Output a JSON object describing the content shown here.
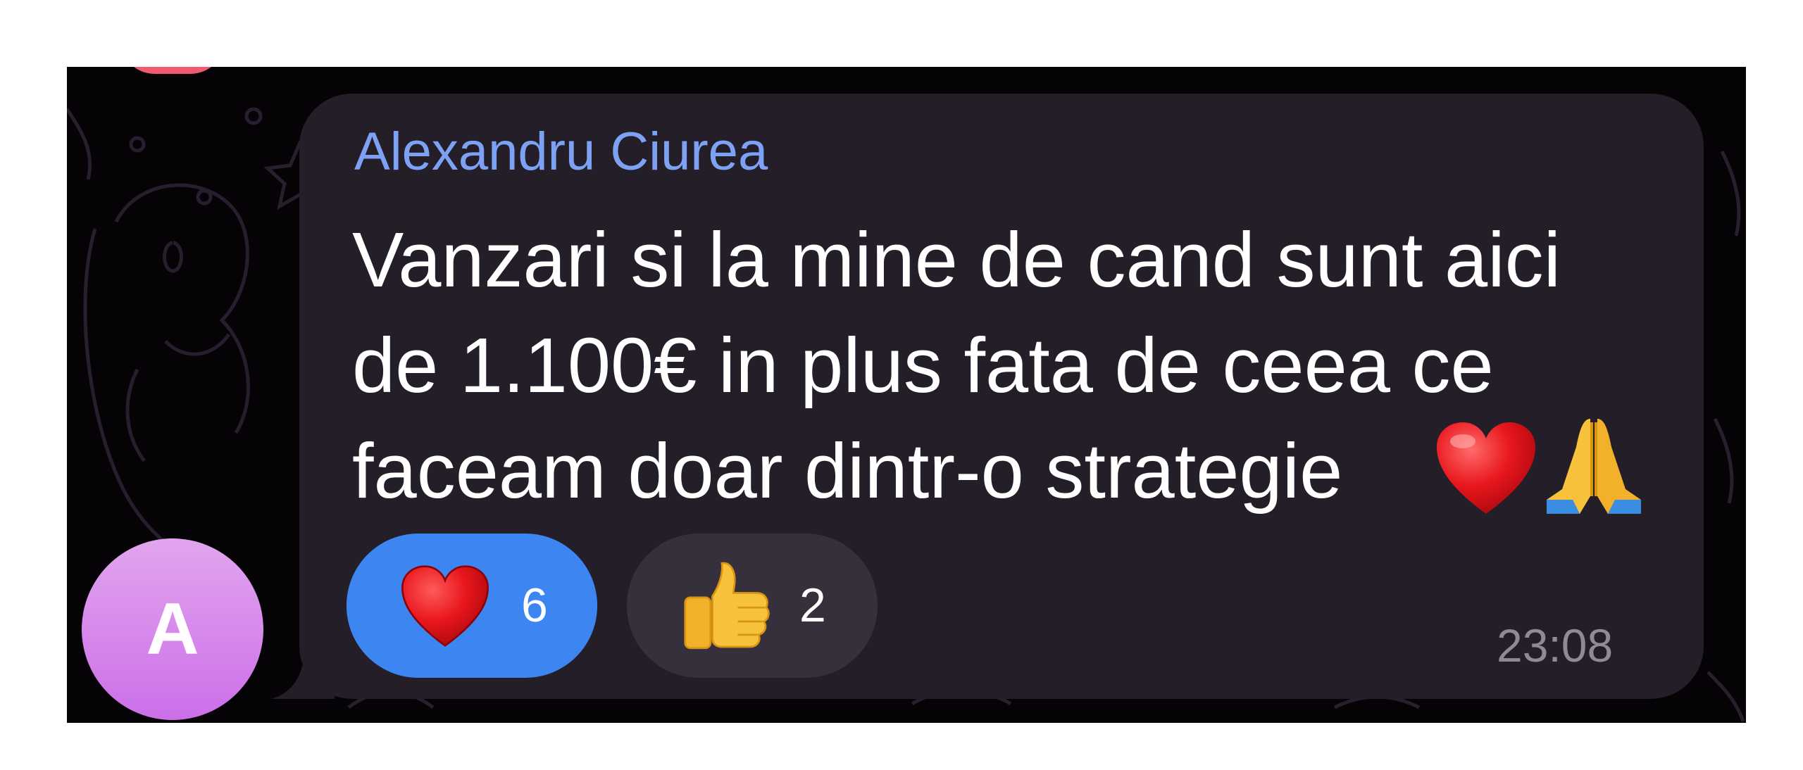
{
  "message": {
    "sender_name": "Alexandru Ciurea",
    "lines": [
      "Vanzari si la mine de cand sunt aici",
      "de 1.100€ in plus fata de ceea ce",
      "faceam doar dintr-o strategie"
    ],
    "trailing_emojis": [
      "heart-emoji",
      "folded-hands-emoji"
    ],
    "time": "23:08",
    "avatar_letter": "A"
  },
  "reactions": [
    {
      "icon": "heart-icon",
      "count": "6",
      "selected": true
    },
    {
      "icon": "thumbs-up-icon",
      "count": "2",
      "selected": false
    }
  ],
  "colors": {
    "sender": "#7da2f4",
    "bubble": "#231e28",
    "background": "#050306",
    "reaction_selected": "#3d86f1",
    "reaction_default": "#35303b",
    "timestamp": "#8e8b94",
    "avatar_top": "#e2a5ee",
    "avatar_bottom": "#cc6fe9"
  }
}
